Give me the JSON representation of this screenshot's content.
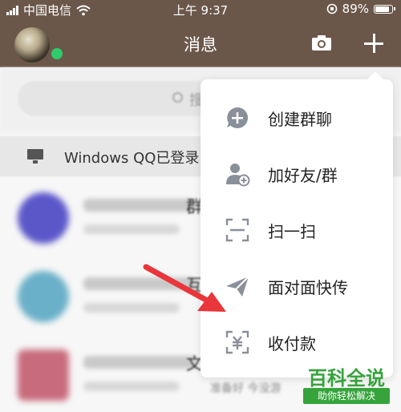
{
  "status_bar": {
    "carrier": "中国电信",
    "time": "上午 9:37",
    "battery": "89%"
  },
  "nav": {
    "title": "消息"
  },
  "search": {
    "placeholder_visible": "搜"
  },
  "pc_login": {
    "text": "Windows QQ已登录"
  },
  "chat_rows": [
    {
      "visible_char": "群",
      "sub": "",
      "avatar_color": "#5b57c9"
    },
    {
      "visible_char": "互",
      "sub": "",
      "avatar_color": "#6ab0c8"
    },
    {
      "visible_char": "文",
      "sub": "准备好  今没游",
      "avatar_color": "#c86b7c"
    }
  ],
  "menu": {
    "items": [
      {
        "label": "创建群聊",
        "icon": "group-chat-plus-icon"
      },
      {
        "label": "加好友/群",
        "icon": "add-friend-icon"
      },
      {
        "label": "扫一扫",
        "icon": "scan-icon"
      },
      {
        "label": "面对面快传",
        "icon": "paper-plane-icon"
      },
      {
        "label": "收付款",
        "icon": "yuan-scan-icon"
      }
    ]
  },
  "watermark": {
    "title": "百科全说",
    "subtitle": "助你轻松解决"
  },
  "colors": {
    "navbar": "#6b574a",
    "online": "#2fcb6a",
    "icon_gray": "#8a9099",
    "arrow": "#e8363a",
    "watermark": "#36a33b"
  }
}
